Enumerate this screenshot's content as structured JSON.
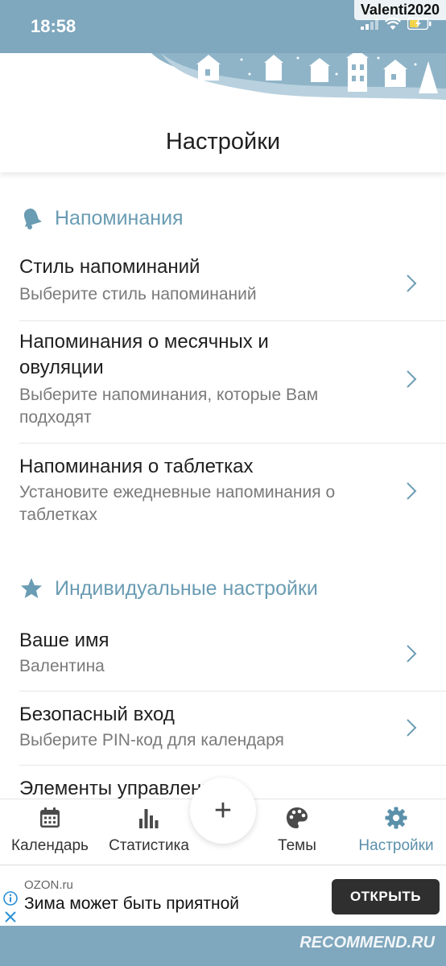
{
  "status_bar": {
    "time": "18:58",
    "watermark_user": "Valenti2020"
  },
  "header": {
    "title": "Настройки"
  },
  "sections": [
    {
      "label": "Напоминания",
      "icon": "bell-icon",
      "items": [
        {
          "title": "Стиль напоминаний",
          "subtitle": "Выберите стиль напоминаний"
        },
        {
          "title_line1": "Напоминания о месячных и",
          "title_line2": "овуляции",
          "subtitle_line1": "Выберите напоминания, которые Вам",
          "subtitle_line2": "подходят"
        },
        {
          "title": "Напоминания о таблетках",
          "subtitle_line1": "Установите ежедневные напоминания о",
          "subtitle_line2": "таблетках"
        }
      ]
    },
    {
      "label": "Индивидуальные настройки",
      "icon": "star-icon",
      "items": [
        {
          "title": "Ваше имя",
          "subtitle": "Валентина"
        },
        {
          "title": "Безопасный вход",
          "subtitle": "Выберите PIN-код для календаря"
        },
        {
          "title": "Элементы управления"
        }
      ]
    }
  ],
  "bottom_nav": {
    "items": [
      {
        "label": "Календарь",
        "icon": "calendar-icon"
      },
      {
        "label": "Статистика",
        "icon": "bar-chart-icon"
      },
      {
        "label": "Темы",
        "icon": "palette-icon"
      },
      {
        "label": "Настройки",
        "icon": "gear-icon",
        "active": true
      }
    ],
    "add_symbol": "+"
  },
  "ad": {
    "source": "OZON.ru",
    "text": "Зима может быть приятной",
    "button_label": "ОТКРЫТЬ"
  },
  "footer": {
    "watermark_site": "RECOMMEND.RU"
  },
  "colors": {
    "accent": "#6a9cb3",
    "status_bar": "#7fa7bd",
    "active_nav": "#5b90aa"
  }
}
